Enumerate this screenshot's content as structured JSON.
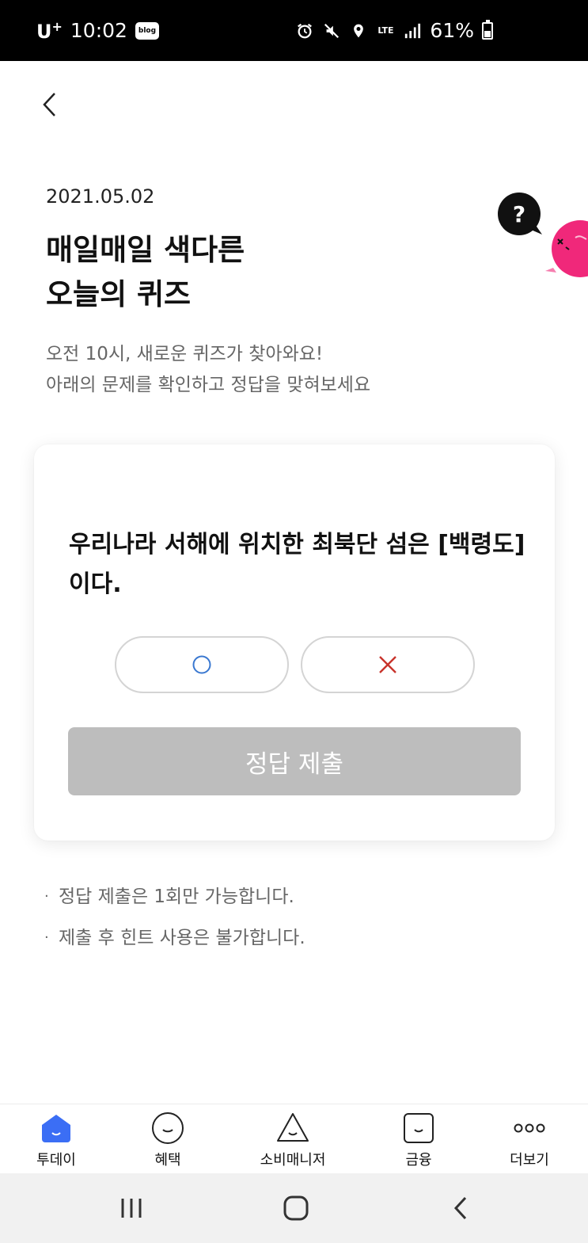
{
  "status_bar": {
    "carrier": "U",
    "carrier_plus": "+",
    "time": "10:02",
    "blog_badge": "blog",
    "network": "LTE",
    "battery": "61%"
  },
  "header": {
    "date": "2021.05.02",
    "title_line1": "매일매일 색다른",
    "title_line2": "오늘의 퀴즈",
    "subtitle_line1": "오전 10시, 새로운 퀴즈가 찾아와요!",
    "subtitle_line2": "아래의 문제를 확인하고 정답을 맞혀보세요"
  },
  "quiz": {
    "question": "우리나라 서해에 위치한 최북단 섬은 [백령도]이다.",
    "option_o_icon": "circle-icon",
    "option_x_icon": "x-icon",
    "submit_label": "정답 제출"
  },
  "notes": [
    "정답 제출은 1회만 가능합니다.",
    "제출 후 힌트 사용은 불가합니다."
  ],
  "tab_bar": {
    "items": [
      {
        "label": "투데이",
        "icon": "today-icon",
        "active": true
      },
      {
        "label": "혜택",
        "icon": "benefit-smile-icon",
        "active": false
      },
      {
        "label": "소비매니저",
        "icon": "triangle-smile-icon",
        "active": false
      },
      {
        "label": "금융",
        "icon": "square-smile-icon",
        "active": false
      },
      {
        "label": "더보기",
        "icon": "more-dots-icon",
        "active": false
      }
    ]
  },
  "colors": {
    "accent_blue": "#3b6ef5",
    "o_color": "#3a78d0",
    "x_color": "#c8332b",
    "submit_disabled": "#bdbdbd",
    "mascot_pink": "#f0287a"
  }
}
